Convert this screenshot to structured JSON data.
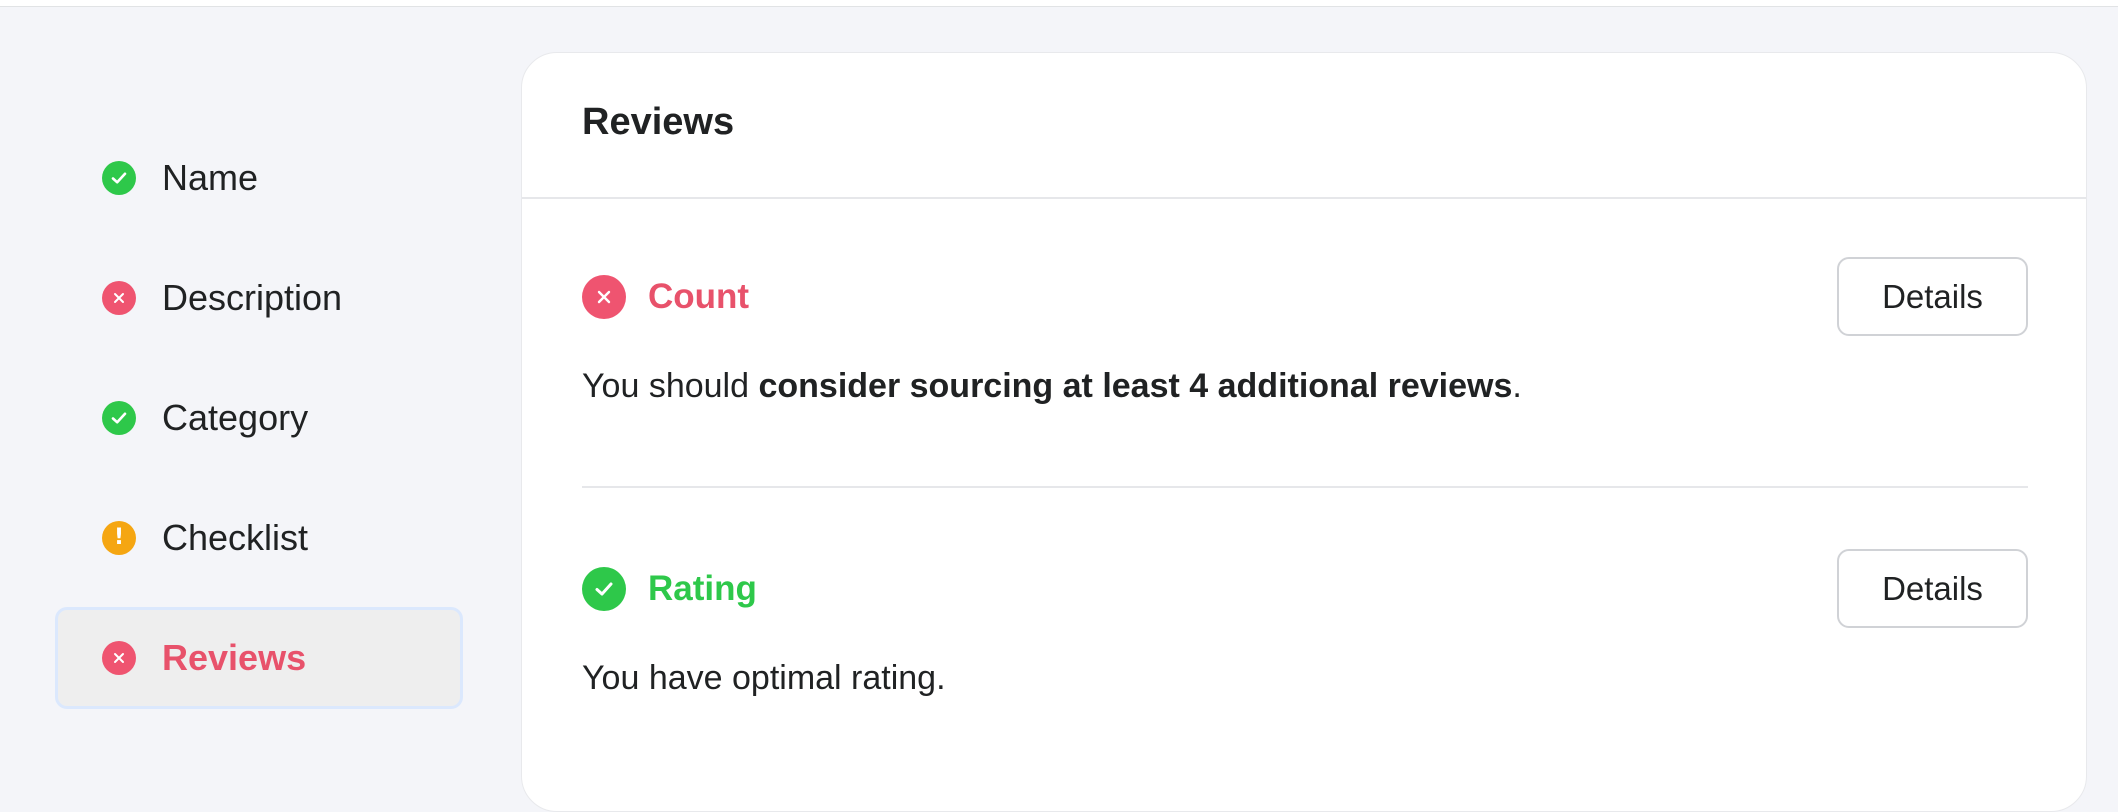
{
  "sidebar": {
    "items": [
      {
        "label": "Name",
        "status": "ok",
        "icon": "check-circle-icon"
      },
      {
        "label": "Description",
        "status": "error",
        "icon": "x-circle-icon"
      },
      {
        "label": "Category",
        "status": "ok",
        "icon": "check-circle-icon"
      },
      {
        "label": "Checklist",
        "status": "warning",
        "icon": "exclamation-circle-icon"
      },
      {
        "label": "Reviews",
        "status": "error",
        "icon": "x-circle-icon",
        "active": true
      }
    ]
  },
  "main": {
    "title": "Reviews",
    "sections": [
      {
        "title": "Count",
        "status": "error",
        "button_label": "Details",
        "message_prefix": "You should ",
        "message_bold": "consider sourcing at least 4 additional reviews",
        "message_suffix": "."
      },
      {
        "title": "Rating",
        "status": "ok",
        "button_label": "Details",
        "message": "You have optimal rating."
      }
    ]
  },
  "colors": {
    "ok": "#2ec84a",
    "error": "#ef5470",
    "warning": "#f5a612",
    "active_border": "#dbe8fd"
  }
}
